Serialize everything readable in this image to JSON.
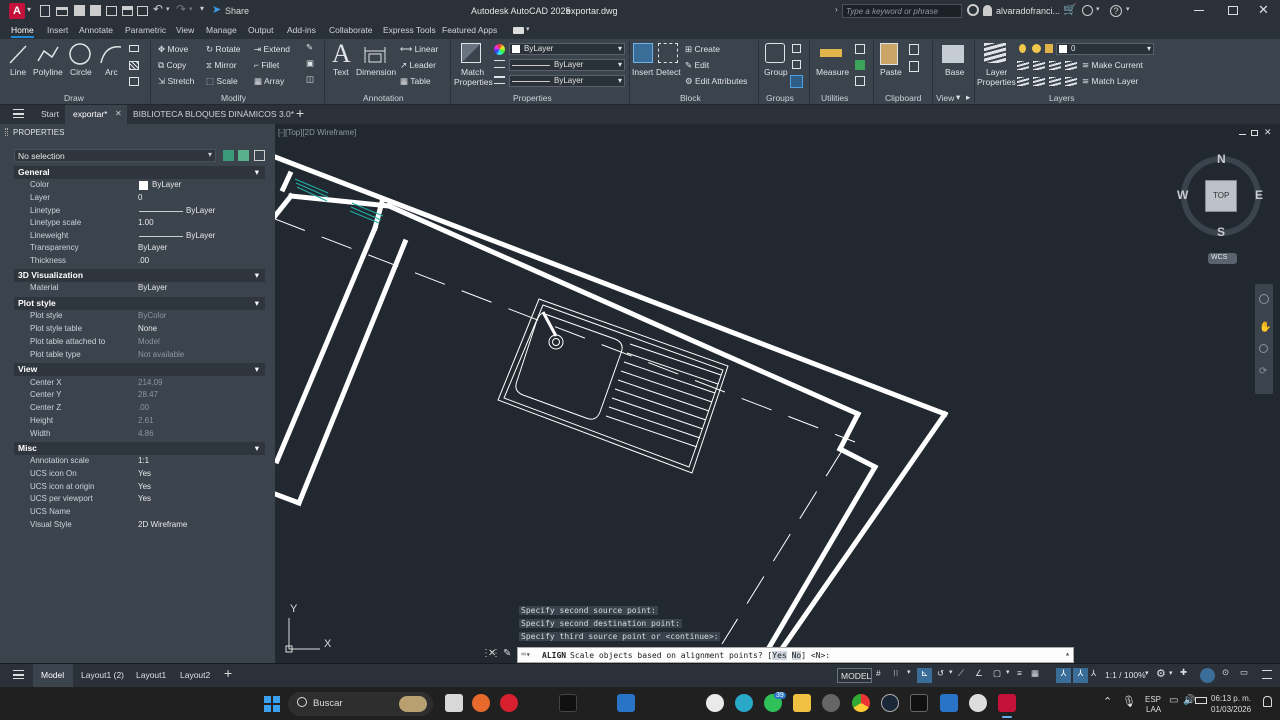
{
  "title": {
    "app": "Autodesk AutoCAD 2025",
    "file": "exportar.dwg",
    "share": "Share",
    "search_placeholder": "Type a keyword or phrase",
    "user": "alvaradofranci..."
  },
  "ribbon_tabs": [
    "Home",
    "Insert",
    "Annotate",
    "Parametric",
    "View",
    "Manage",
    "Output",
    "Add-ins",
    "Collaborate",
    "Express Tools",
    "Featured Apps"
  ],
  "ribbon": {
    "draw": {
      "label": "Draw",
      "line": "Line",
      "polyline": "Polyline",
      "circle": "Circle",
      "arc": "Arc"
    },
    "modify": {
      "label": "Modify",
      "move": "Move",
      "rotate": "Rotate",
      "extend": "Extend",
      "copy": "Copy",
      "mirror": "Mirror",
      "fillet": "Fillet",
      "stretch": "Stretch",
      "scale": "Scale",
      "array": "Array"
    },
    "annotation": {
      "label": "Annotation",
      "text": "Text",
      "dimension": "Dimension",
      "linear": "Linear",
      "leader": "Leader",
      "table": "Table"
    },
    "properties": {
      "label": "Properties",
      "match_1": "Match",
      "match_2": "Properties",
      "color": "ByLayer",
      "linetype": "ByLayer",
      "lineweight": "ByLayer"
    },
    "block": {
      "label": "Block",
      "insert": "Insert",
      "detect": "Detect",
      "create": "Create",
      "edit": "Edit",
      "edit_attributes": "Edit Attributes"
    },
    "groups": {
      "label": "Groups",
      "group": "Group"
    },
    "utilities": {
      "label": "Utilities",
      "measure": "Measure"
    },
    "clipboard": {
      "label": "Clipboard",
      "paste": "Paste"
    },
    "view": {
      "label": "View",
      "base": "Base"
    },
    "layers": {
      "label": "Layers",
      "layer_props_1": "Layer",
      "layer_props_2": "Properties",
      "current_layer": "0",
      "make_current": "Make Current",
      "match_layer": "Match Layer"
    }
  },
  "doc_tabs": {
    "start": "Start",
    "exportar": "exportar*",
    "biblioteca": "BIBLIOTECA BLOQUES DINÁMICOS 3.0*"
  },
  "properties_palette": {
    "title": "PROPERTIES",
    "selection": "No selection",
    "sections": {
      "general": "General",
      "viz3d": "3D Visualization",
      "plotstyle": "Plot style",
      "view": "View",
      "misc": "Misc"
    },
    "general": [
      {
        "k": "Color",
        "v": "ByLayer"
      },
      {
        "k": "Layer",
        "v": "0"
      },
      {
        "k": "Linetype",
        "v": "ByLayer"
      },
      {
        "k": "Linetype scale",
        "v": "1.00"
      },
      {
        "k": "Lineweight",
        "v": "ByLayer"
      },
      {
        "k": "Transparency",
        "v": "ByLayer"
      },
      {
        "k": "Thickness",
        "v": ".00"
      }
    ],
    "viz3d": [
      {
        "k": "Material",
        "v": "ByLayer"
      }
    ],
    "plotstyle": [
      {
        "k": "Plot style",
        "v": "ByColor"
      },
      {
        "k": "Plot style table",
        "v": "None"
      },
      {
        "k": "Plot table attached to",
        "v": "Model"
      },
      {
        "k": "Plot table type",
        "v": "Not available"
      }
    ],
    "view": [
      {
        "k": "Center X",
        "v": "214.09"
      },
      {
        "k": "Center Y",
        "v": "28.47"
      },
      {
        "k": "Center Z",
        "v": ".00"
      },
      {
        "k": "Height",
        "v": "2.61"
      },
      {
        "k": "Width",
        "v": "4.86"
      }
    ],
    "misc": [
      {
        "k": "Annotation scale",
        "v": "1:1"
      },
      {
        "k": "UCS icon On",
        "v": "Yes"
      },
      {
        "k": "UCS icon at origin",
        "v": "Yes"
      },
      {
        "k": "UCS per viewport",
        "v": "Yes"
      },
      {
        "k": "UCS Name",
        "v": ""
      },
      {
        "k": "Visual Style",
        "v": "2D Wireframe"
      }
    ]
  },
  "viewport": {
    "label": "[-][Top][2D Wireframe]",
    "viewcube": {
      "top": "TOP",
      "n": "N",
      "s": "S",
      "e": "E",
      "w": "W",
      "wcs": "WCS"
    },
    "ucs_x": "X",
    "ucs_y": "Y"
  },
  "command": {
    "history": [
      "Specify second source point:",
      "Specify second destination point:",
      "Specify third source point or <continue>:"
    ],
    "prompt_cmd": "ALIGN",
    "prompt_text": "Scale objects based on alignment points? [",
    "opt_yes": "Yes",
    "opt_no": "No",
    "prompt_end": "] <N>:"
  },
  "layout_tabs": {
    "model": "Model",
    "layout1_2": "Layout1 (2)",
    "layout1": "Layout1",
    "layout2": "Layout2"
  },
  "status": {
    "model": "MODEL",
    "scale": "1:1 / 100%"
  },
  "taskbar": {
    "search": "Buscar",
    "lang_1": "ESP",
    "lang_2": "LAA",
    "time": "06:13 p. m.",
    "date": "01/03/2026",
    "badge": "39"
  }
}
